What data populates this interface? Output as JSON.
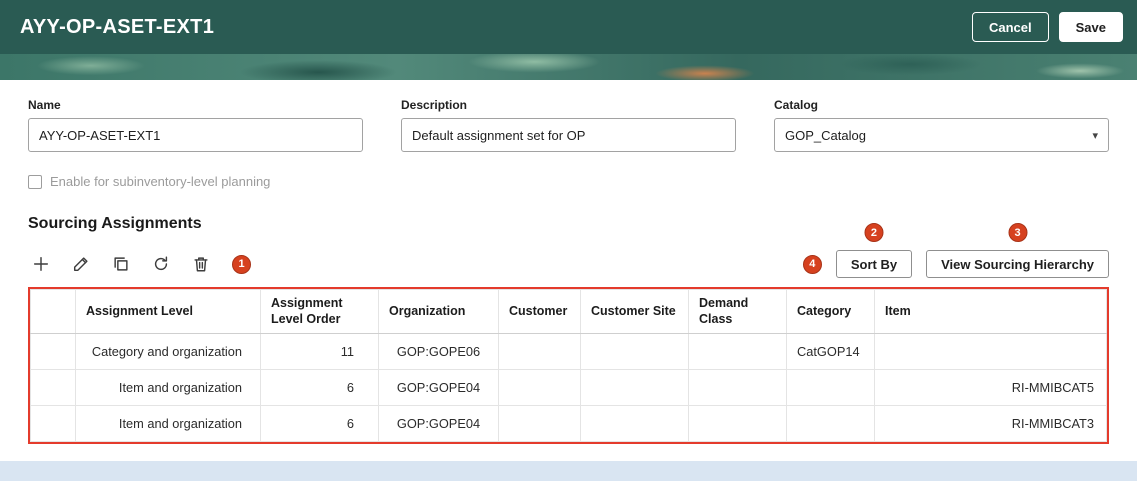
{
  "header": {
    "title": "AYY-OP-ASET-EXT1",
    "cancel_label": "Cancel",
    "save_label": "Save"
  },
  "form": {
    "name": {
      "label": "Name",
      "value": "AYY-OP-ASET-EXT1"
    },
    "description": {
      "label": "Description",
      "value": "Default assignment set for OP"
    },
    "catalog": {
      "label": "Catalog",
      "value": "GOP_Catalog"
    },
    "checkbox_label": "Enable for subinventory-level planning",
    "checkbox_checked": false
  },
  "sourcing": {
    "title": "Sourcing Assignments",
    "toolbar_icons": [
      "add-icon",
      "edit-icon",
      "duplicate-icon",
      "refresh-icon",
      "delete-icon"
    ],
    "sort_by_label": "Sort By",
    "view_hierarchy_label": "View Sourcing Hierarchy",
    "annotations": [
      "1",
      "2",
      "3",
      "4"
    ]
  },
  "table": {
    "columns": [
      "",
      "Assignment Level",
      "Assignment Level Order",
      "Organization",
      "Customer",
      "Customer Site",
      "Demand Class",
      "Category",
      "Item"
    ],
    "rows": [
      [
        "",
        "Category and organization",
        "11",
        "GOP:GOPE06",
        "",
        "",
        "",
        "CatGOP14",
        ""
      ],
      [
        "",
        "Item and organization",
        "6",
        "GOP:GOPE04",
        "",
        "",
        "",
        "",
        "RI-MMIBCAT5"
      ],
      [
        "",
        "Item and organization",
        "6",
        "GOP:GOPE04",
        "",
        "",
        "",
        "",
        "RI-MMIBCAT3"
      ]
    ]
  },
  "colors": {
    "header_teal": "#2a5b53",
    "annotation_red": "#e43b2c",
    "badge_orange": "#d6411f",
    "page_background": "#d9e5f2"
  }
}
